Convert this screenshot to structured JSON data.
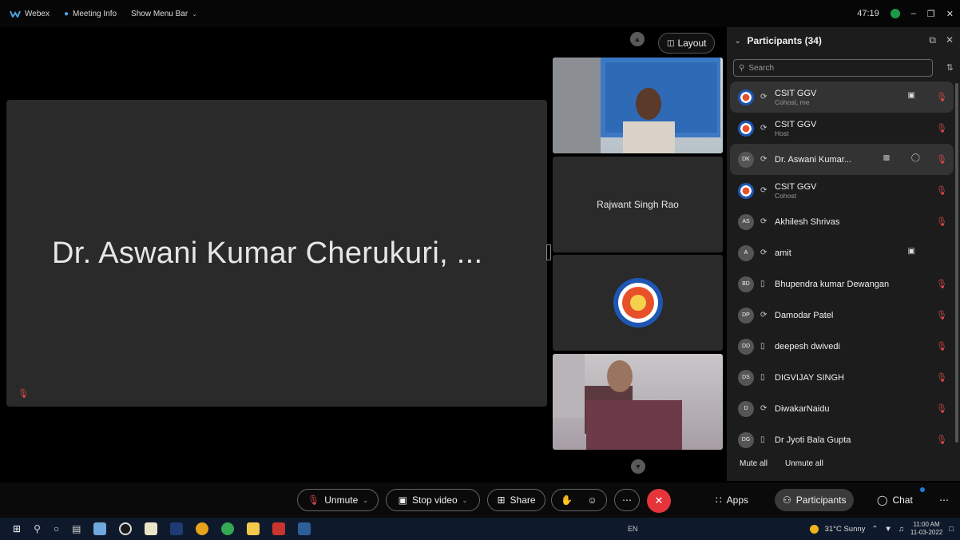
{
  "titlebar": {
    "app_name": "Webex",
    "meeting_info": "Meeting Info",
    "show_menu_bar": "Show Menu Bar",
    "timer": "47:19"
  },
  "stage": {
    "layout_label": "Layout",
    "active_speaker_name": "Dr. Aswani Kumar Cherukuri, ...",
    "tile2_name": "Rajwant Singh Rao"
  },
  "panel": {
    "title": "Participants (34)",
    "search_placeholder": "Search",
    "participants": [
      {
        "initials": "",
        "name": "CSIT GGV",
        "role": "Cohost, me",
        "logo": true
      },
      {
        "initials": "",
        "name": "CSIT GGV",
        "role": "Host",
        "logo": true
      },
      {
        "initials": "DK",
        "name": "Dr. Aswani Kumar...",
        "role": "",
        "logo": false
      },
      {
        "initials": "",
        "name": "CSIT GGV",
        "role": "Cohost",
        "logo": true
      },
      {
        "initials": "AS",
        "name": "Akhilesh Shrivas",
        "role": "",
        "logo": false
      },
      {
        "initials": "A",
        "name": "amit",
        "role": "",
        "logo": false
      },
      {
        "initials": "BD",
        "name": "Bhupendra kumar Dewangan",
        "role": "",
        "logo": false
      },
      {
        "initials": "DP",
        "name": "Damodar Patel",
        "role": "",
        "logo": false
      },
      {
        "initials": "DD",
        "name": "deepesh dwivedi",
        "role": "",
        "logo": false
      },
      {
        "initials": "DS",
        "name": "DIGVIJAY SINGH",
        "role": "",
        "logo": false
      },
      {
        "initials": "D",
        "name": "DiwakarNaidu",
        "role": "",
        "logo": false
      },
      {
        "initials": "DG",
        "name": "Dr Jyoti Bala Gupta",
        "role": "",
        "logo": false
      }
    ],
    "mute_all": "Mute all",
    "unmute_all": "Unmute all"
  },
  "controls": {
    "unmute": "Unmute",
    "stop_video": "Stop video",
    "share": "Share",
    "apps": "Apps",
    "participants": "Participants",
    "chat": "Chat"
  },
  "taskbar": {
    "lang": "EN",
    "weather": "31°C Sunny",
    "time": "11:00 AM",
    "date": "11-03-2022"
  },
  "colors": {
    "end_call": "#e5343a",
    "mute_red": "#e04a4a",
    "panel_bg": "#1c1c1c",
    "status_green": "#1c9a4a"
  }
}
